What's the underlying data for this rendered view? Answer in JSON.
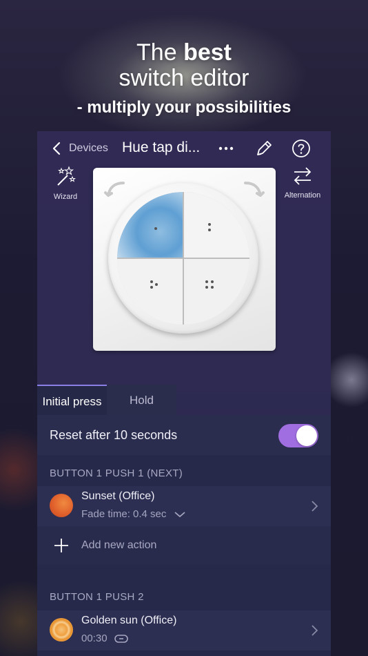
{
  "headline": {
    "line1_prefix": "The ",
    "line1_bold": "best",
    "line2": "switch editor",
    "line3": "- multiply your possibilities"
  },
  "navbar": {
    "back_label": "Devices",
    "title": "Hue tap di..."
  },
  "toolbar": {
    "wizard_label": "Wizard",
    "alternation_label": "Alternation"
  },
  "tabs": [
    {
      "label": "Initial press",
      "selected": true
    },
    {
      "label": "Hold",
      "selected": false
    }
  ],
  "reset": {
    "label": "Reset after 10 seconds",
    "enabled": true
  },
  "sections": [
    {
      "header": "BUTTON 1 PUSH 1 (NEXT)",
      "action": {
        "name": "Sunset (Office)",
        "sub": "Fade time: 0.4 sec"
      },
      "add_label": "Add new action"
    },
    {
      "header": "BUTTON 1 PUSH 2",
      "action": {
        "name": "Golden sun (Office)",
        "sub": "00:30"
      }
    }
  ],
  "colors": {
    "accent": "#a06ee0",
    "tab_indicator": "#8a7fe6",
    "sunset": "#e0602c",
    "golden_sun": "#f0a040"
  }
}
